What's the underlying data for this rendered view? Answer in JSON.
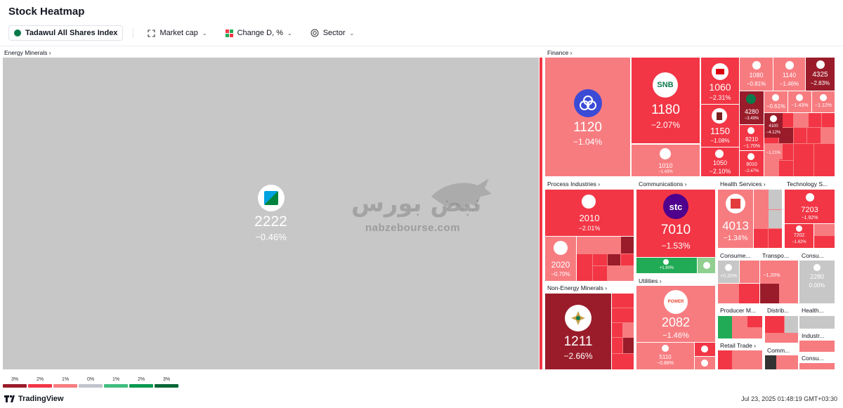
{
  "title": "Stock Heatmap",
  "toolbar": {
    "index_label": "Tadawul All Shares Index",
    "size_label": "Market cap",
    "color_label": "Change D, %",
    "group_label": "Sector"
  },
  "colors": {
    "gray": "#c7c7c7",
    "red_dark": "#9a1c2a",
    "red": "#f23645",
    "red_light": "#f77c80",
    "green": "#22ab56",
    "green_dark": "#056636",
    "teal_brand": "#0b7a4b"
  },
  "sectors": {
    "energy": "Energy Minerals",
    "finance": "Finance",
    "process": "Process Industries",
    "comms": "Communications",
    "health": "Health Services",
    "tech": "Technology S...",
    "non_energy": "Non-Energy Minerals",
    "utilities": "Utilities",
    "consumer1": "Consume...",
    "transport": "Transpo...",
    "consumer2": "Consu...",
    "producer": "Producer M...",
    "distrib": "Distrib...",
    "health_tech": "Health...",
    "retail": "Retail Trade",
    "commercial": "Comm...",
    "industrial": "Industr...",
    "consumer3": "Consu..."
  },
  "tiles": {
    "t2222": {
      "sym": "2222",
      "chg": "−0.46%"
    },
    "t1120": {
      "sym": "1120",
      "chg": "−1.04%"
    },
    "t1180": {
      "sym": "1180",
      "chg": "−2.07%"
    },
    "t1060": {
      "sym": "1060",
      "chg": "−2.31%"
    },
    "t1080": {
      "sym": "1080",
      "chg": "−0.81%"
    },
    "t1140": {
      "sym": "1140",
      "chg": "−1.46%"
    },
    "t4325": {
      "sym": "4325",
      "chg": "−2.83%"
    },
    "t1150": {
      "sym": "1150",
      "chg": "−1.08%"
    },
    "t4280": {
      "sym": "4280",
      "chg": "−3.49%"
    },
    "t1010": {
      "sym": "1010",
      "chg": "−1.43%"
    },
    "t1050": {
      "sym": "1050",
      "chg": "−2.10%"
    },
    "t8210": {
      "sym": "8210",
      "chg": "−1.70%"
    },
    "t8010": {
      "sym": "8010",
      "chg": "−2.47%"
    },
    "t4100": {
      "sym": "4100",
      "chg": "−4.12%"
    },
    "f_a": {
      "chg": "−0.61%"
    },
    "f_b": {
      "chg": "−1.43%"
    },
    "f_c": {
      "chg": "−1.12%"
    },
    "f_d": {
      "chg": "−1.21%"
    },
    "t2010": {
      "sym": "2010",
      "chg": "−2.01%"
    },
    "t2020": {
      "sym": "2020",
      "chg": "−0.70%"
    },
    "t7010": {
      "sym": "7010",
      "chg": "−1.53%"
    },
    "c_a": {
      "chg": "+1.90%"
    },
    "t4013": {
      "sym": "4013",
      "chg": "−1.34%"
    },
    "t7203": {
      "sym": "7203",
      "chg": "−1.92%"
    },
    "t7202": {
      "sym": "7202",
      "chg": "−1.62%"
    },
    "t1211": {
      "sym": "1211",
      "chg": "−2.66%"
    },
    "t2082": {
      "sym": "2082",
      "chg": "−1.46%"
    },
    "t5110": {
      "sym": "5110",
      "chg": "−0.88%"
    },
    "cons_a": {
      "chg": "+0.20%"
    },
    "tr_a": {
      "chg": "−1.20%"
    },
    "t2280": {
      "sym": "2280",
      "chg": "0.00%"
    }
  },
  "logos": {
    "snb": "SNB",
    "stc": "stc",
    "power": "POWER"
  },
  "watermark": {
    "arabic": "نبض بورس",
    "latin": "nabzebourse.com"
  },
  "legend": [
    {
      "label": "3%",
      "color": "#9a1c2a"
    },
    {
      "label": "2%",
      "color": "#f23645"
    },
    {
      "label": "1%",
      "color": "#f77c80"
    },
    {
      "label": "0%",
      "color": "#c1c4cd"
    },
    {
      "label": "1%",
      "color": "#42bd7f"
    },
    {
      "label": "2%",
      "color": "#089950"
    },
    {
      "label": "3%",
      "color": "#056636"
    }
  ],
  "brand": "TradingView",
  "timestamp": "Jul 23, 2025 01:48:19 GMT+03:30"
}
